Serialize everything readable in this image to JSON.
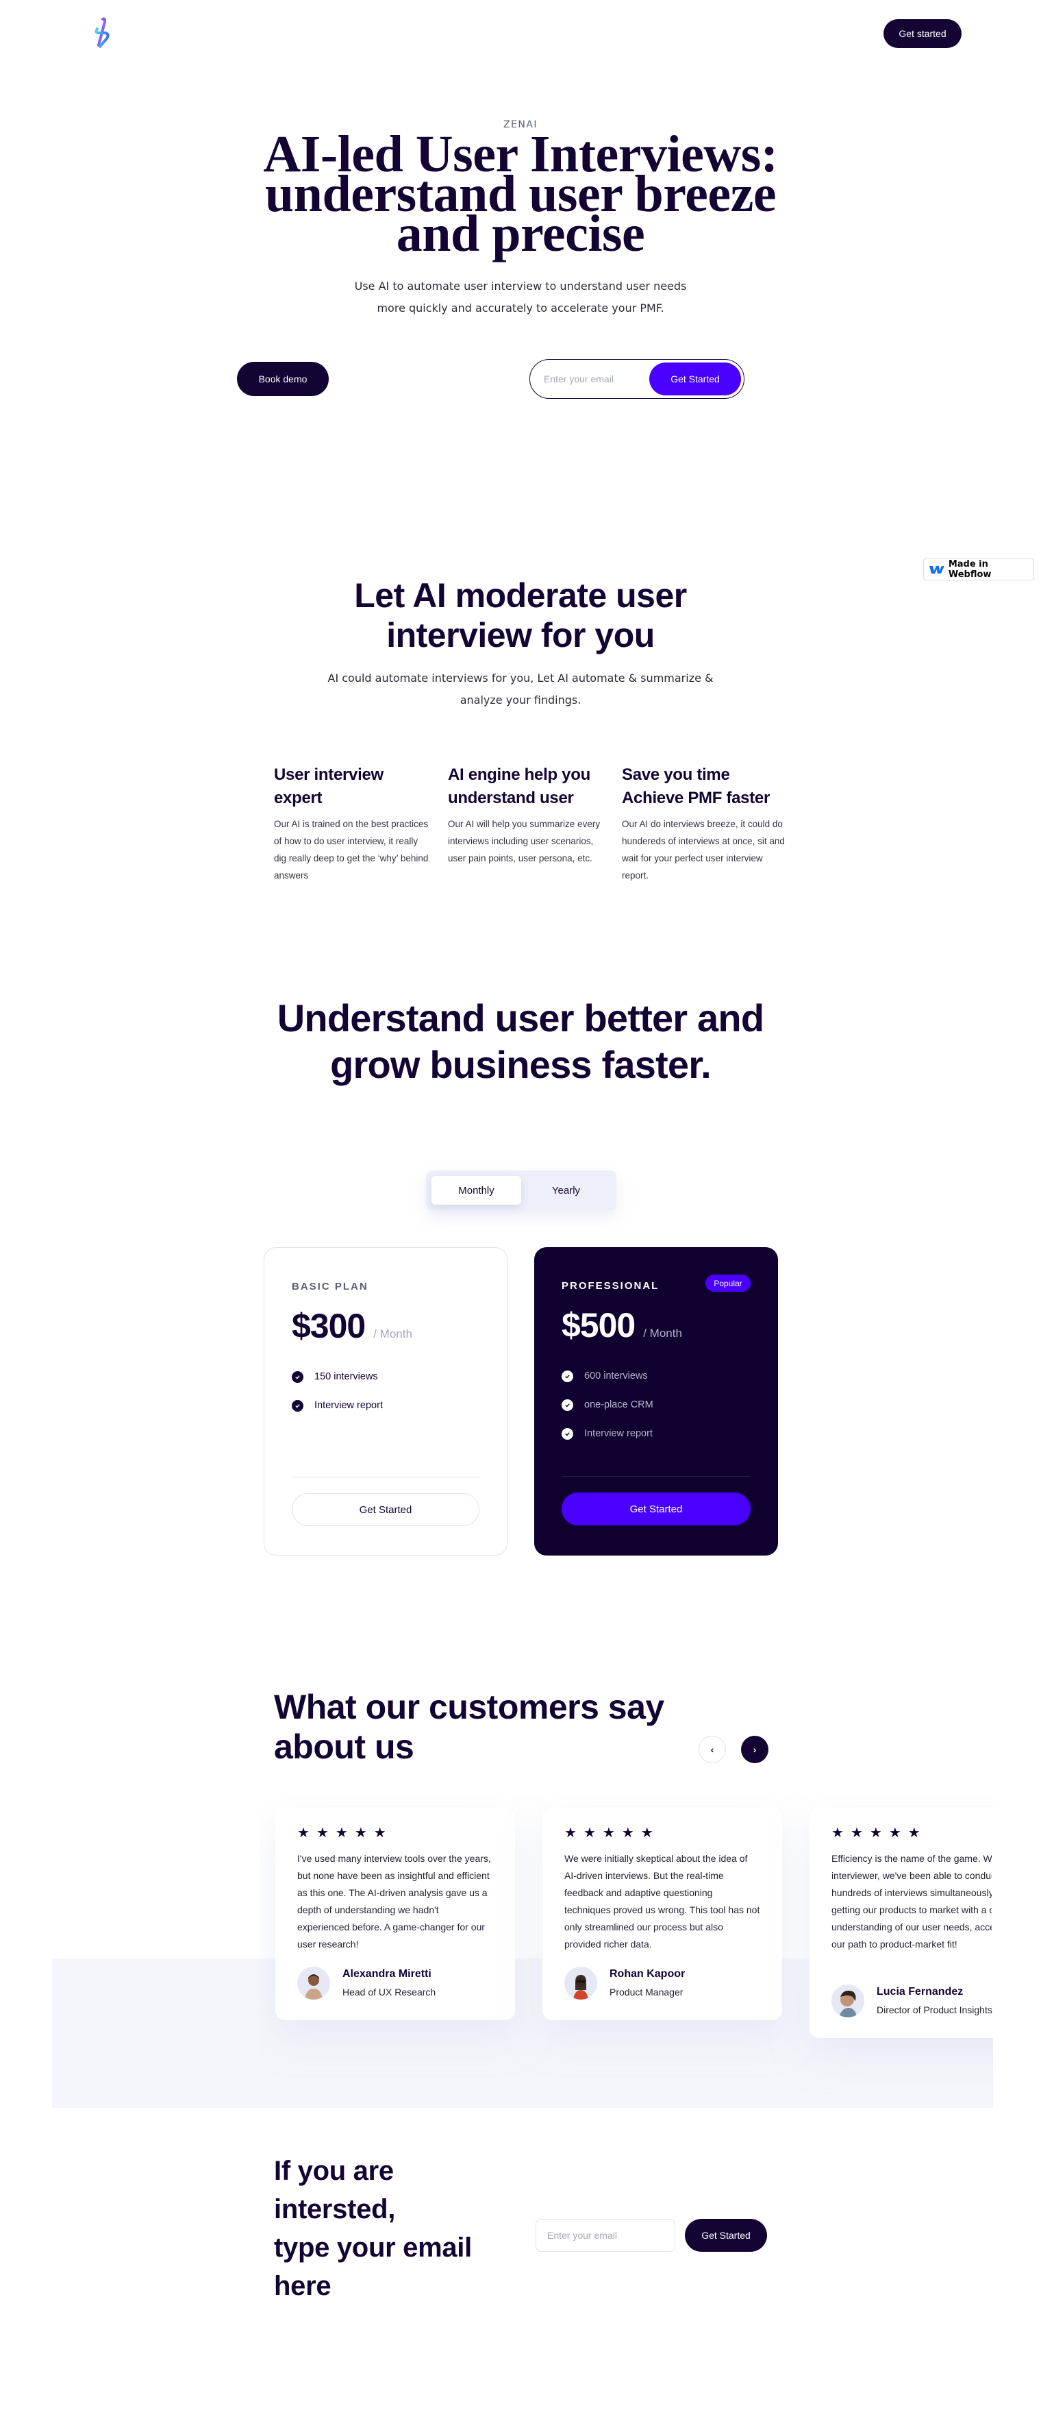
{
  "brand": {
    "logo_icon": "zenai-logo-icon",
    "eyebrow": "ZENAI",
    "colors": {
      "primary_dark": "#140433",
      "accent": "#4a00ff",
      "card_dark": "#100030",
      "muted": "#a3a6bb",
      "soft_bg": "#f4f6fb"
    }
  },
  "nav": {
    "cta_label": "Get started"
  },
  "hero": {
    "title_line1": "AI-led User Interviews:",
    "title_line2": "understand user breeze",
    "title_line3": "and precise",
    "subtitle_line1": "Use AI to automate user interview to understand user needs",
    "subtitle_line2": "more quickly and accurately to accelerate your PMF.",
    "book_demo_label": "Book demo",
    "email_placeholder": "Enter your email",
    "email_value": "",
    "submit_label": "Get Started"
  },
  "webflow_badge": {
    "icon": "webflow-logo-icon",
    "label": "Made in Webflow"
  },
  "features_section": {
    "title_line1": "Let AI moderate user",
    "title_line2": "interview for you",
    "subtitle_line1": "AI could automate interviews for you, Let AI automate & summarize &",
    "subtitle_line2": "analyze your findings.",
    "features": [
      {
        "title": "User interview expert",
        "body": "Our AI is trained on the best practices of how to do user interview, it really dig really deep to get the ‘why’ behind answers"
      },
      {
        "title": "AI engine help you understand user",
        "body": "Our AI will help you summarize every interviews including user scenarios, user pain points, user persona, etc."
      },
      {
        "title": "Save you time Achieve PMF faster",
        "body": "Our AI do interviews breeze, it could do hundereds of interviews at once, sit and wait for your perfect user interview report."
      }
    ]
  },
  "pricing": {
    "title": "Understand user better and grow business faster.",
    "toggle": {
      "options": [
        "Monthly",
        "Yearly"
      ],
      "selected": "Monthly"
    },
    "plans": [
      {
        "name": "BASIC PLAN",
        "price": "$300",
        "period": "/ Month",
        "badge": null,
        "features": [
          "150 interviews",
          "Interview report"
        ],
        "cta": "Get Started"
      },
      {
        "name": "PROFESSIONAL",
        "price": "$500",
        "period": "/ Month",
        "badge": "Popular",
        "features": [
          "600 interviews",
          "one-place CRM",
          "Interview report"
        ],
        "cta": "Get Started"
      }
    ]
  },
  "testimonials": {
    "title": "What our customers say about us",
    "prev_icon": "chevron-left-icon",
    "next_icon": "chevron-right-icon",
    "items": [
      {
        "rating": 5,
        "quote": "I've used many interview tools over the years, but none have been as insightful and efficient as this one. The AI-driven analysis gave us a depth of understanding we hadn't experienced before. A game-changer for our user research!",
        "name": "Alexandra Miretti",
        "role": "Head of UX Research"
      },
      {
        "rating": 5,
        "quote": "We were initially skeptical about the idea of AI-driven interviews. But the real-time feedback and adaptive questioning techniques proved us wrong. This tool has not only streamlined our process but also provided richer data.",
        "name": "Rohan Kapoor",
        "role": "Product Manager"
      },
      {
        "rating": 5,
        "quote_lines": [
          "Efficiency is the name of the game. Wi",
          "interviewer, we've been able to conduc",
          "hundreds of interviews simultaneously.",
          "getting our products to market with a c",
          "understanding of our user needs, acce",
          "our path to product-market fit!"
        ],
        "name": "Lucia Fernandez",
        "role": "Director of Product Insights"
      }
    ]
  },
  "cta_section": {
    "title_lines": [
      "If you are",
      "intersted,",
      "type your email",
      "here"
    ],
    "email_placeholder": "Enter your email",
    "email_value": "",
    "submit_label": "Get Started"
  }
}
